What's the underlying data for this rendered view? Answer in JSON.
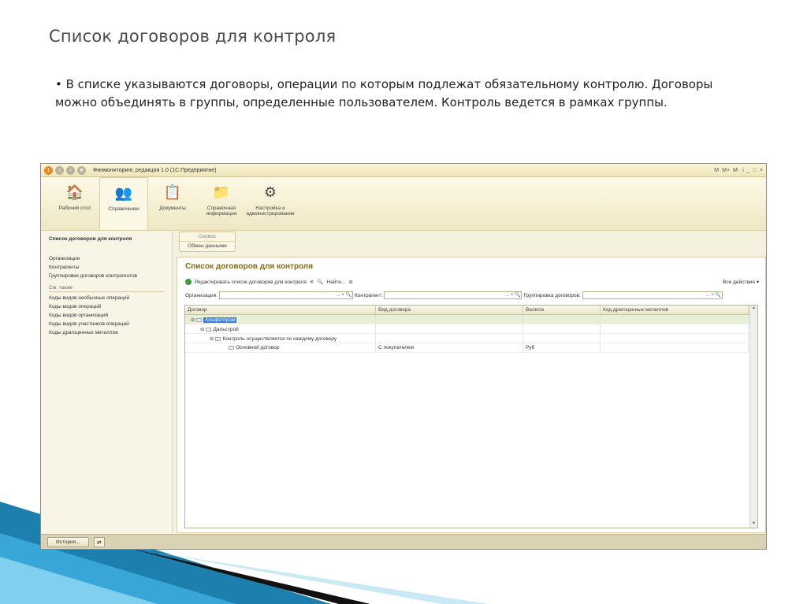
{
  "slide": {
    "title": "Список договоров для контроля",
    "bullet": "• В списке указываются договоры, операции по которым подлежат обязательному контролю. Договоры можно объединять в группы, определенные пользователем. Контроль ведется в рамках группы."
  },
  "window": {
    "title": "Финмониторинг, редакция 1.0  (1С:Предприятие)",
    "right_buttons": [
      "M",
      "M+",
      "M-",
      "i",
      "_",
      "□",
      "×"
    ]
  },
  "sections": [
    {
      "icon": "🏠",
      "label": "Рабочий стол"
    },
    {
      "icon": "👥",
      "label": "Справочники"
    },
    {
      "icon": "📋",
      "label": "Документы"
    },
    {
      "icon": "📁",
      "label": "Справочная информация"
    },
    {
      "icon": "⚙",
      "label": "Настройка и администрирование"
    }
  ],
  "leftpane": {
    "title": "Список договоров для контроля",
    "items": [
      "Организации",
      "Контрагенты",
      "Группировки договоров контрагентов"
    ],
    "see_also": "См. также",
    "see_items": [
      "Коды видов необычных операций",
      "Коды видов операций",
      "Коды видов организаций",
      "Коды видов участников операций",
      "Коды драгоценных металлов"
    ]
  },
  "service": {
    "head": "Сервис",
    "item": "Обмен данными"
  },
  "content": {
    "title": "Список договоров для контроля",
    "edit_cmd": "Редактировать список договоров для контроля",
    "find_cmd": "Найти...",
    "all_actions": "Все действия ▾",
    "filter_org": "Организация:",
    "filter_contr": "Контрагент:",
    "filter_group": "Группировка договоров:"
  },
  "grid": {
    "columns": [
      "Договор",
      "Вид договора",
      "Валюта",
      "Код драгоценных металлов"
    ],
    "rows": [
      {
        "name": "Конфетпром",
        "kind": "",
        "currency": "",
        "code": ""
      },
      {
        "name": "Дальстрой",
        "kind": "",
        "currency": "",
        "code": ""
      },
      {
        "name": "Контроль осуществляется по каждому договору",
        "kind": "",
        "currency": "",
        "code": ""
      },
      {
        "name": "Основной договор",
        "kind": "С покупателем",
        "currency": "Руб",
        "code": ""
      }
    ]
  },
  "statusbar": {
    "history": "История..."
  },
  "colors": {
    "accent_title": "#8a6a1a",
    "selection": "#3b7de0"
  }
}
